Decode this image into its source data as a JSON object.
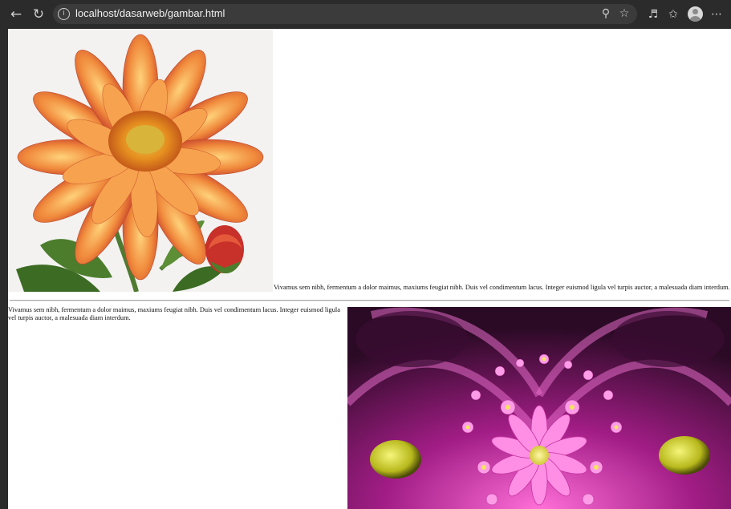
{
  "browser": {
    "url": "localhost/dasarweb/gambar.html",
    "icons": [
      "back-icon",
      "refresh-icon",
      "info-icon",
      "zoom-icon",
      "favorite-star-icon",
      "read-aloud-icon",
      "favorites-icon",
      "profile-avatar",
      "more-icon"
    ]
  },
  "page": {
    "top_caption": "Vivamus sem nibh, fermentum a dolor maimus, maxiums feugiat nibh. Duis vel condimentum lacus. Integer euismod ligula vel turpis auctor, a malesuada diam interdum.",
    "bottom_paragraph": "Vivamus sem nibh, fermentum a dolor maimus, maxiums feugiat nibh. Duis vel condimentum lacus. Integer euismod ligula vel turpis auctor, a malesuada diam interdum."
  },
  "colors": {
    "chrome": "#2b2b2b",
    "address_bar": "#3b3b3b",
    "page_bg": "#ffffff"
  }
}
